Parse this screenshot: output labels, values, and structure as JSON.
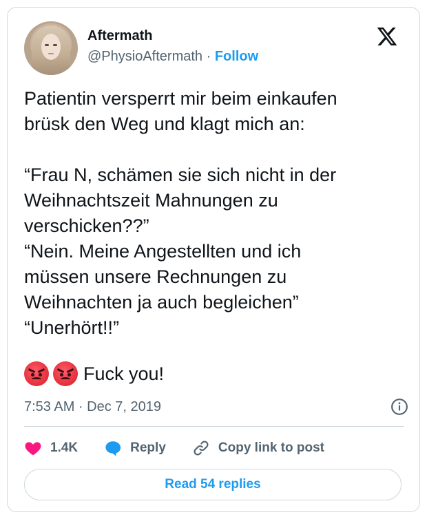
{
  "author": {
    "name": "Aftermath",
    "handle": "@PhysioAftermath",
    "separator": "·",
    "follow_label": "Follow"
  },
  "brand_icon": "x-logo-icon",
  "tweet": {
    "text": "Patientin versperrt mir beim einkaufen\nbrüsk den Weg und klagt mich an:\n\n“Frau N, schämen sie sich nicht in der\nWeihnachtszeit Mahnungen zu\nverschicken??”\n“Nein. Meine Angestellten und ich\nmüssen unsere Rechnungen zu\nWeihnachten ja auch begleichen”\n“Unerhört!!”",
    "emoji_icons": [
      "angry-face-icon",
      "angry-face-icon"
    ],
    "tail_text": "Fuck you!",
    "timestamp": "7:53 AM · Dec 7, 2019"
  },
  "actions": {
    "likes_count": "1.4K",
    "reply_label": "Reply",
    "copy_link_label": "Copy link to post"
  },
  "read_replies_label": "Read 54 replies",
  "colors": {
    "accent": "#1d9bf0",
    "like": "#f91880",
    "muted": "#536471",
    "border": "#cfd9de"
  }
}
